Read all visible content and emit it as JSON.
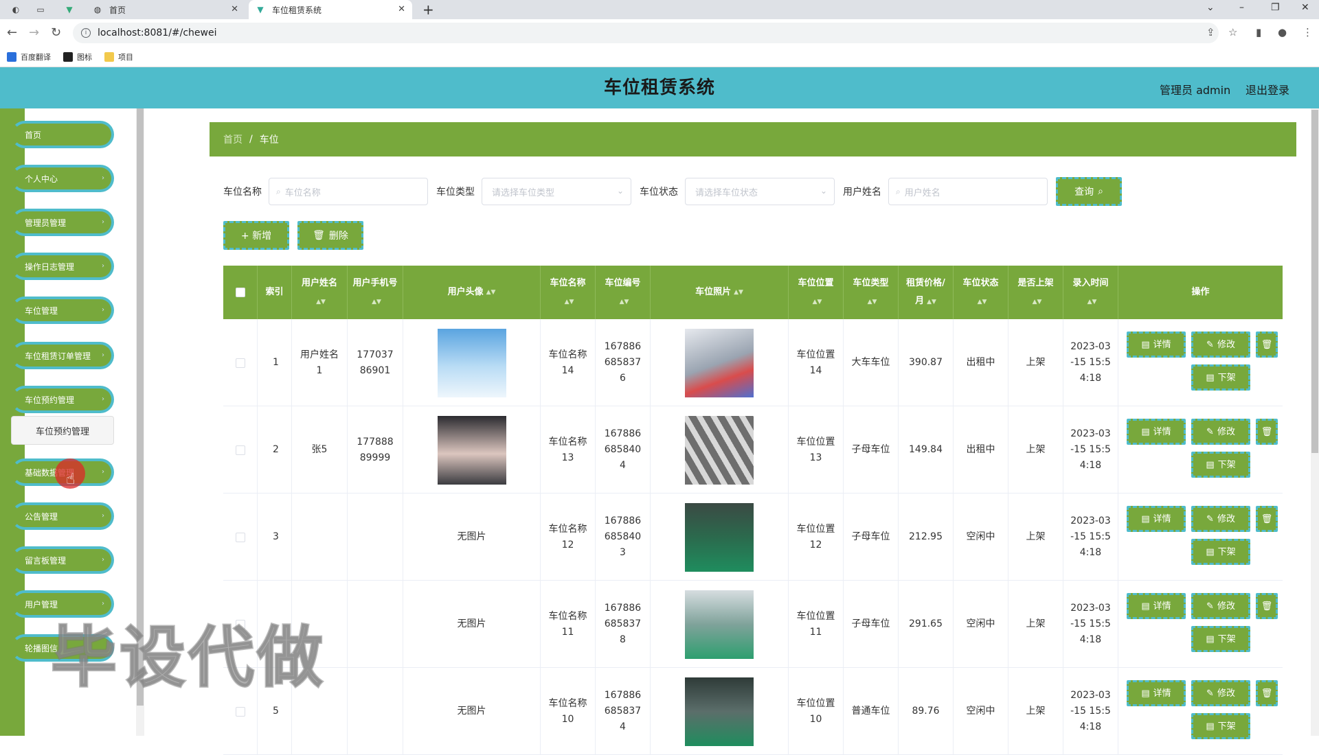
{
  "browser": {
    "tabs": [
      {
        "title": "首页",
        "active": false
      },
      {
        "title": "车位租赁系统",
        "active": true
      }
    ],
    "url": "localhost:8081/#/chewei",
    "bookmarks": [
      "百度翻译",
      "图标",
      "项目"
    ]
  },
  "header": {
    "title": "车位租赁系统",
    "user": "管理员 admin",
    "logout": "退出登录"
  },
  "sidebar": {
    "items": [
      {
        "label": "首页"
      },
      {
        "label": "个人中心"
      },
      {
        "label": "管理员管理"
      },
      {
        "label": "操作日志管理"
      },
      {
        "label": "车位管理"
      },
      {
        "label": "车位租赁订单管理"
      },
      {
        "label": "车位预约管理"
      },
      {
        "label": "基础数据管理"
      },
      {
        "label": "公告管理"
      },
      {
        "label": "留言板管理"
      },
      {
        "label": "用户管理"
      },
      {
        "label": "轮播图信"
      }
    ],
    "submenu_label": "车位预约管理"
  },
  "watermark": "毕设代做",
  "breadcrumb": {
    "home": "首页",
    "separator": "/",
    "current": "车位"
  },
  "search": {
    "name_label": "车位名称",
    "name_placeholder": "车位名称",
    "type_label": "车位类型",
    "type_placeholder": "请选择车位类型",
    "status_label": "车位状态",
    "status_placeholder": "请选择车位状态",
    "user_label": "用户姓名",
    "user_placeholder": "用户姓名",
    "query_label": "查询"
  },
  "actions": {
    "add_label": "+ 新增",
    "delete_label": "删除"
  },
  "table": {
    "headers": {
      "index": "索引",
      "username": "用户姓名",
      "phone": "用户手机号",
      "avatar": "用户头像",
      "spot_name": "车位名称",
      "spot_no": "车位编号",
      "spot_photo": "车位照片",
      "location": "车位位置",
      "type": "车位类型",
      "price": "租赁价格/月",
      "status": "车位状态",
      "listed": "是否上架",
      "created": "录入时间",
      "ops": "操作"
    },
    "op_labels": {
      "detail": "详情",
      "edit": "修改",
      "unlist": "下架"
    },
    "rows": [
      {
        "index": "1",
        "username": "用户姓名1",
        "phone": "17703786901",
        "avatar": "image",
        "spot_name": "车位名称14",
        "spot_no": "1678866858376",
        "photo": "image",
        "location": "车位位置14",
        "type": "大车车位",
        "price": "390.87",
        "status": "出租中",
        "listed": "上架",
        "created": "2023-03-15 15:54:18"
      },
      {
        "index": "2",
        "username": "张5",
        "phone": "17788889999",
        "avatar": "image",
        "spot_name": "车位名称13",
        "spot_no": "1678866858404",
        "photo": "image",
        "location": "车位位置13",
        "type": "子母车位",
        "price": "149.84",
        "status": "出租中",
        "listed": "上架",
        "created": "2023-03-15 15:54:18"
      },
      {
        "index": "3",
        "username": "",
        "phone": "",
        "avatar": "无图片",
        "spot_name": "车位名称12",
        "spot_no": "1678866858403",
        "photo": "image",
        "location": "车位位置12",
        "type": "子母车位",
        "price": "212.95",
        "status": "空闲中",
        "listed": "上架",
        "created": "2023-03-15 15:54:18"
      },
      {
        "index": "",
        "username": "",
        "phone": "",
        "avatar": "无图片",
        "spot_name": "车位名称11",
        "spot_no": "1678866858378",
        "photo": "image",
        "location": "车位位置11",
        "type": "子母车位",
        "price": "291.65",
        "status": "空闲中",
        "listed": "上架",
        "created": "2023-03-15 15:54:18"
      },
      {
        "index": "5",
        "username": "",
        "phone": "",
        "avatar": "无图片",
        "spot_name": "车位名称10",
        "spot_no": "1678866858374",
        "photo": "image",
        "location": "车位位置10",
        "type": "普通车位",
        "price": "89.76",
        "status": "空闲中",
        "listed": "上架",
        "created": "2023-03-15 15:54:18"
      }
    ]
  },
  "colors": {
    "header": "#4fbccb",
    "accent": "#78a83c"
  }
}
